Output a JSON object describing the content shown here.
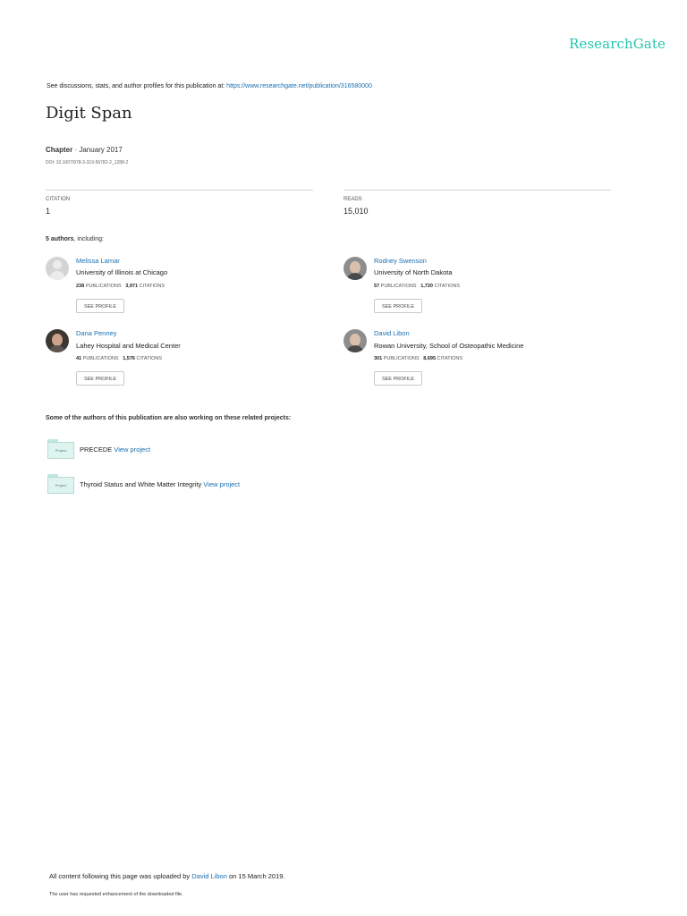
{
  "brand": "ResearchGate",
  "header": {
    "discussions_text": "See discussions, stats, and author profiles for this publication at: ",
    "publication_url": "https://www.researchgate.net/publication/316580000"
  },
  "title": "Digit Span",
  "meta": {
    "type": "Chapter",
    "date": " · January 2017",
    "doi": "DOI: 10.1007/978-3-319-56782-2_1288-2"
  },
  "stats": {
    "citation_label": "CITATION",
    "citation_value": "1",
    "reads_label": "READS",
    "reads_value": "15,010"
  },
  "authors_heading": {
    "count": "5 authors",
    "suffix": ", including:"
  },
  "authors": [
    {
      "name": "Melissa Lamar",
      "institution": "University of Illinois at Chicago",
      "publications": "238",
      "publications_label": "PUBLICATIONS",
      "citations": "3,971",
      "citations_label": "CITATIONS",
      "button": "SEE PROFILE"
    },
    {
      "name": "Rodney Swenson",
      "institution": "University of North Dakota",
      "publications": "57",
      "publications_label": "PUBLICATIONS",
      "citations": "1,720",
      "citations_label": "CITATIONS",
      "button": "SEE PROFILE"
    },
    {
      "name": "Dana Penney",
      "institution": "Lahey Hospital and Medical Center",
      "publications": "41",
      "publications_label": "PUBLICATIONS",
      "citations": "1,576",
      "citations_label": "CITATIONS",
      "button": "SEE PROFILE"
    },
    {
      "name": "David Libon",
      "institution": "Rowan University, School of Osteopathic Medicine",
      "publications": "301",
      "publications_label": "PUBLICATIONS",
      "citations": "8,695",
      "citations_label": "CITATIONS",
      "button": "SEE PROFILE"
    }
  ],
  "related_heading": "Some of the authors of this publication are also working on these related projects:",
  "projects": [
    {
      "icon_label": "Project",
      "name": "PRECEDE ",
      "link": "View project"
    },
    {
      "icon_label": "Project",
      "name": "Thyroid Status and White Matter Integrity ",
      "link": "View project"
    }
  ],
  "footer": {
    "uploaded_prefix": "All content following this page was uploaded by ",
    "uploader": "David Libon",
    "uploaded_suffix": " on 15 March 2019.",
    "enhancement_note": "The user has requested enhancement of the downloaded file."
  },
  "colors": {
    "brand": "#22c6b0",
    "link": "#1a6fb0"
  }
}
